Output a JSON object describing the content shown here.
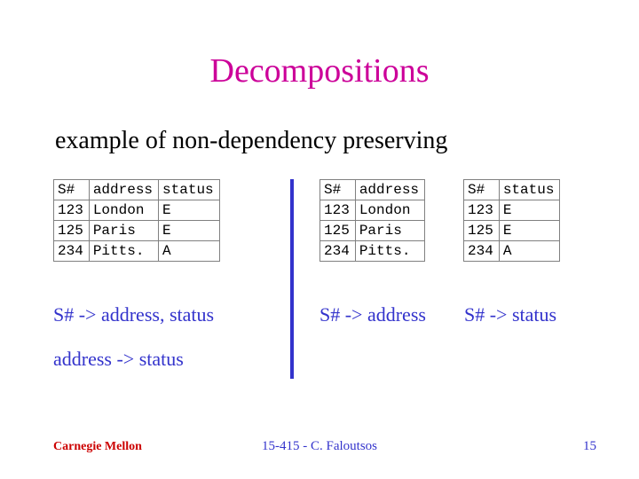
{
  "title": "Decompositions",
  "subtitle": "example of non-dependency preserving",
  "tables": {
    "full": {
      "headers": [
        "S#",
        "address",
        "status"
      ],
      "rows": [
        [
          "123",
          "London",
          "E"
        ],
        [
          "125",
          "Paris",
          "E"
        ],
        [
          "234",
          "Pitts.",
          "A"
        ]
      ]
    },
    "addr": {
      "headers": [
        "S#",
        "address"
      ],
      "rows": [
        [
          "123",
          "London"
        ],
        [
          "125",
          "Paris"
        ],
        [
          "234",
          "Pitts."
        ]
      ]
    },
    "stat": {
      "headers": [
        "S#",
        "status"
      ],
      "rows": [
        [
          "123",
          "E"
        ],
        [
          "125",
          "E"
        ],
        [
          "234",
          "A"
        ]
      ]
    }
  },
  "fds": {
    "left1": "S# -> address, status",
    "left2": "address -> status",
    "mid": "S# -> address",
    "right": "S# -> status"
  },
  "footer": {
    "org": "Carnegie Mellon",
    "center": "15-415 - C. Faloutsos",
    "page": "15"
  }
}
